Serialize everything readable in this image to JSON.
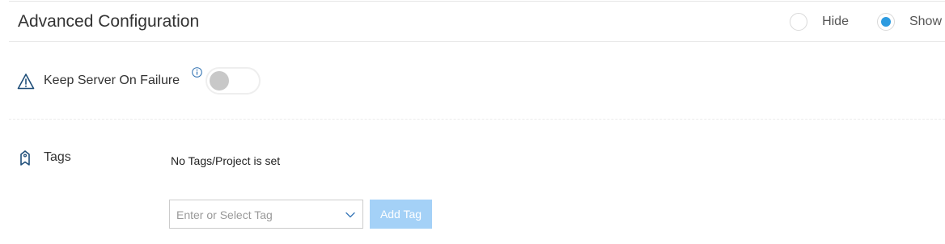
{
  "section": {
    "title": "Advanced Configuration",
    "visibility": {
      "options": [
        {
          "label": "Hide",
          "selected": false
        },
        {
          "label": "Show",
          "selected": true
        }
      ]
    }
  },
  "keep_server": {
    "label": "Keep Server On Failure",
    "info_icon": "info-icon",
    "warning_icon": "warning-icon",
    "toggle_on": false
  },
  "tags": {
    "label": "Tags",
    "icon": "tag-icon",
    "empty_message": "No Tags/Project is set",
    "select_placeholder": "Enter or Select Tag",
    "add_button_label": "Add Tag"
  },
  "colors": {
    "accent": "#2d9be0",
    "button_disabled_bg": "#a4d1f7",
    "icon_blue": "#1f4e79"
  }
}
